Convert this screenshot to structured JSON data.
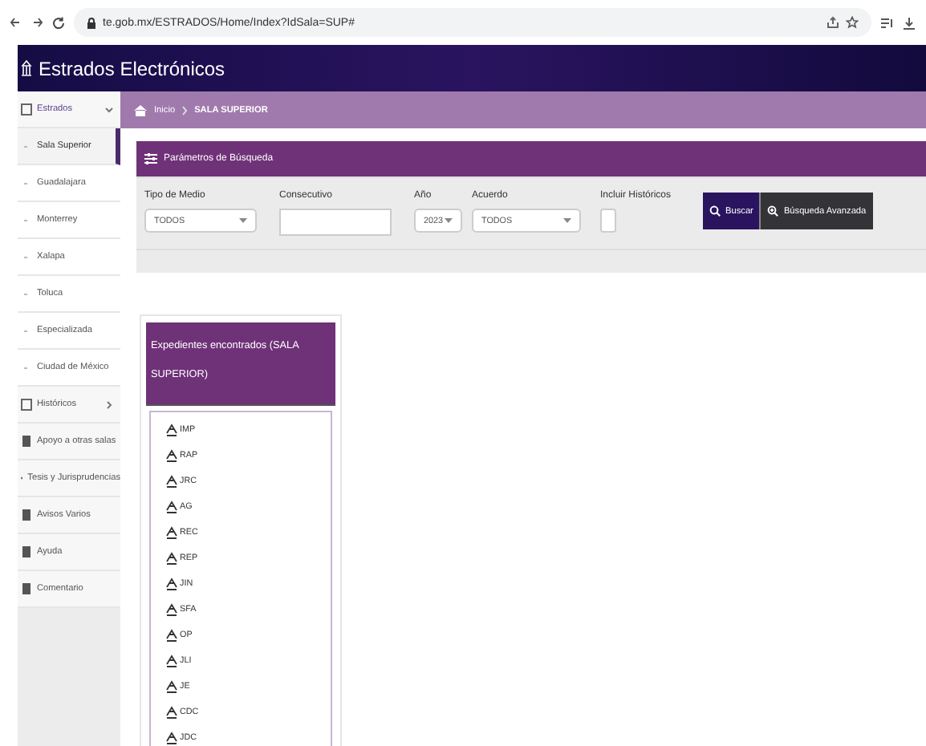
{
  "browser": {
    "url": "te.gob.mx/ESTRADOS/Home/Index?IdSala=SUP#"
  },
  "app": {
    "title": "Estrados Electrónicos"
  },
  "sidebar": {
    "items": [
      {
        "label": "Estrados",
        "kind": "group",
        "expanded": true,
        "children": [
          {
            "label": "Sala Superior",
            "selected": true
          },
          {
            "label": "Guadalajara",
            "selected": false
          },
          {
            "label": "Monterrey",
            "selected": false
          },
          {
            "label": "Xalapa",
            "selected": false
          },
          {
            "label": "Toluca",
            "selected": false
          },
          {
            "label": "Especializada",
            "selected": false
          },
          {
            "label": "Ciudad de México",
            "selected": false
          }
        ]
      },
      {
        "label": "Históricos",
        "kind": "group",
        "expanded": false
      },
      {
        "label": "Apoyo a otras salas",
        "kind": "link"
      },
      {
        "label": "Tesis y Jurisprudencias",
        "kind": "link"
      },
      {
        "label": "Avisos Varios",
        "kind": "link"
      },
      {
        "label": "Ayuda",
        "kind": "link"
      },
      {
        "label": "Comentario",
        "kind": "link"
      }
    ]
  },
  "breadcrumb": [
    "Inicio",
    "SALA SUPERIOR"
  ],
  "search_panel": {
    "title": "Parámetros de Búsqueda",
    "fields": [
      {
        "label": "Tipo de Medio",
        "kind": "select",
        "value": "TODOS"
      },
      {
        "label": "Consecutivo",
        "kind": "text"
      },
      {
        "label": "Año",
        "kind": "select",
        "value": "2023"
      },
      {
        "label": "Acuerdo",
        "kind": "select",
        "value": "TODOS"
      },
      {
        "label": "Incluir Históricos",
        "kind": "checkbox",
        "checked": false
      }
    ],
    "buttons": [
      {
        "label": "Buscar",
        "kind": "primary"
      },
      {
        "label": "Búsqueda Avanzada",
        "kind": "secondary"
      }
    ]
  },
  "results": {
    "title": "Expedientes encontrados (SALA SUPERIOR)",
    "items": [
      "IMP",
      "RAP",
      "JRC",
      "AG",
      "REC",
      "REP",
      "JIN",
      "SFA",
      "OP",
      "JLI",
      "JE",
      "CDC",
      "JDC"
    ]
  }
}
